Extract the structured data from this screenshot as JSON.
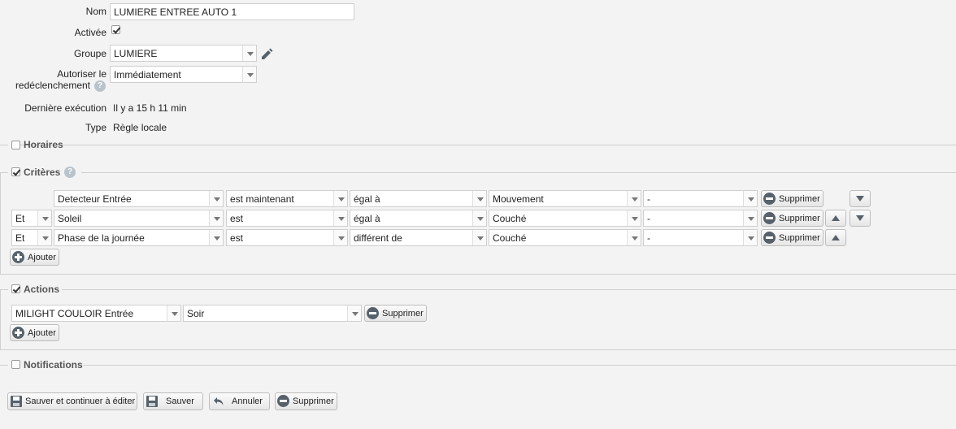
{
  "form": {
    "nom_label": "Nom",
    "nom_value": "LUMIERE ENTREE AUTO 1",
    "activee_label": "Activée",
    "activee_checked": true,
    "groupe_label": "Groupe",
    "groupe_value": "LUMIERE",
    "autoriser_label_1": "Autoriser le",
    "autoriser_label_2": "redéclenchement",
    "autoriser_value": "Immédiatement",
    "derniere_label": "Dernière exécution",
    "derniere_value": "Il y a 15 h 11 min",
    "type_label": "Type",
    "type_value": "Règle locale"
  },
  "sections": {
    "horaires": "Horaires",
    "criteres": "Critères",
    "actions": "Actions",
    "notifications": "Notifications"
  },
  "criteria": {
    "rows": [
      {
        "conj": "",
        "device": "Detecteur Entrée",
        "state": "est maintenant",
        "op": "égal à",
        "value": "Mouvement",
        "extra": "-"
      },
      {
        "conj": "Et",
        "device": "Soleil",
        "state": "est",
        "op": "égal à",
        "value": "Couché",
        "extra": "-"
      },
      {
        "conj": "Et",
        "device": "Phase de la journée",
        "state": "est",
        "op": "différent de",
        "value": "Couché",
        "extra": "-"
      }
    ],
    "delete_label": "Supprimer",
    "add_label": "Ajouter"
  },
  "actions": {
    "device": "MILIGHT COULOIR Entrée",
    "scene": "Soir",
    "delete_label": "Supprimer",
    "add_label": "Ajouter"
  },
  "footer": {
    "save_continue": "Sauver et continuer à éditer",
    "save": "Sauver",
    "cancel": "Annuler",
    "delete": "Supprimer"
  },
  "icons": {
    "edit": "pencil-icon",
    "help": "help-icon",
    "delete": "minus-circle-icon",
    "add": "plus-circle-icon",
    "save": "floppy-icon",
    "undo": "undo-icon"
  }
}
